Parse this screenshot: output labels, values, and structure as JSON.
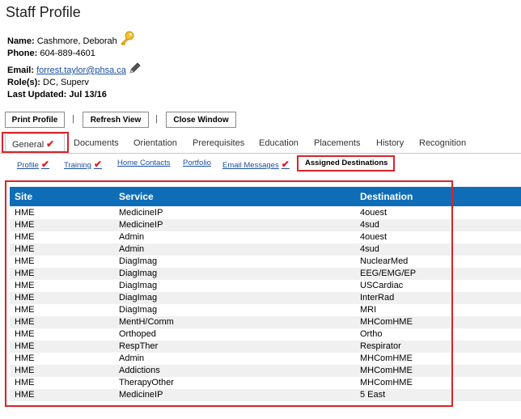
{
  "page": {
    "title": "Staff Profile"
  },
  "profile": {
    "name_label": "Name:",
    "name_value": "Cashmore, Deborah",
    "phone_label": "Phone:",
    "phone_value": "604-889-4601",
    "email_label": "Email:",
    "email_value": "forrest.taylor@phsa.ca",
    "roles_label": "Role(s):",
    "roles_value": "DC, Superv",
    "updated_label": "Last Updated:",
    "updated_value": "Jul 13/16"
  },
  "toolbar": {
    "print_label": "Print Profile",
    "refresh_label": "Refresh View",
    "close_label": "Close Window",
    "separator": "|"
  },
  "tabs": [
    "General",
    "Documents",
    "Orientation",
    "Prerequisites",
    "Education",
    "Placements",
    "History",
    "Recognition"
  ],
  "subtabs": [
    "Profile",
    "Training",
    "Home Contacts",
    "Portfolio",
    "Email Messages",
    "Assigned Destinations"
  ],
  "check_mark": "✔",
  "table": {
    "headers": [
      "Site",
      "Service",
      "Destination"
    ],
    "rows": [
      [
        "HME",
        "MedicineIP",
        "4ouest"
      ],
      [
        "HME",
        "MedicineIP",
        "4sud"
      ],
      [
        "HME",
        "Admin",
        "4ouest"
      ],
      [
        "HME",
        "Admin",
        "4sud"
      ],
      [
        "HME",
        "DiagImag",
        "NuclearMed"
      ],
      [
        "HME",
        "DiagImag",
        "EEG/EMG/EP"
      ],
      [
        "HME",
        "DiagImag",
        "USCardiac"
      ],
      [
        "HME",
        "DiagImag",
        "InterRad"
      ],
      [
        "HME",
        "DiagImag",
        "MRI"
      ],
      [
        "HME",
        "MentH/Comm",
        "MHComHME"
      ],
      [
        "HME",
        "Orthoped",
        "Ortho"
      ],
      [
        "HME",
        "RespTher",
        "Respirator"
      ],
      [
        "HME",
        "Admin",
        "MHComHME"
      ],
      [
        "HME",
        "Addictions",
        "MHComHME"
      ],
      [
        "HME",
        "TherapyOther",
        "MHComHME"
      ],
      [
        "HME",
        "MedicineIP",
        "5 East"
      ]
    ]
  },
  "colors": {
    "header_bg": "#0f6db7",
    "highlight": "#d8232a",
    "link": "#1a4fa3"
  }
}
